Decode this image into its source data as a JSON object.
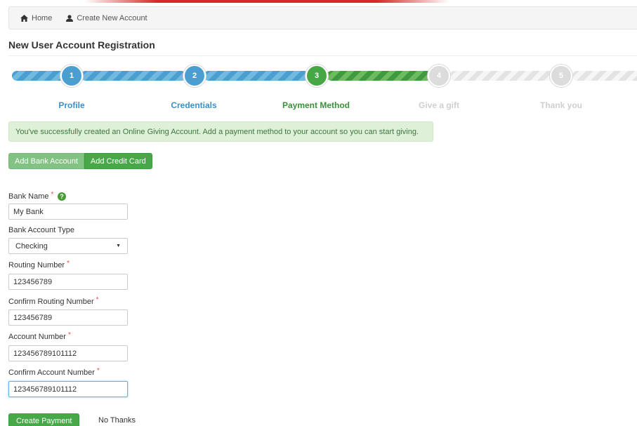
{
  "breadcrumb": {
    "home_label": "Home",
    "current_label": "Create New Account",
    "home_icon": "home-icon",
    "user_icon": "user-icon"
  },
  "page": {
    "title": "New User Account Registration"
  },
  "wizard": {
    "current_step": 3,
    "steps": [
      {
        "number": "1",
        "label": "Profile",
        "state": "complete"
      },
      {
        "number": "2",
        "label": "Credentials",
        "state": "complete"
      },
      {
        "number": "3",
        "label": "Payment Method",
        "state": "active"
      },
      {
        "number": "4",
        "label": "Give a gift",
        "state": "pending"
      },
      {
        "number": "5",
        "label": "Thank you",
        "state": "pending"
      }
    ]
  },
  "alert": {
    "message": "You've successfully created an Online Giving Account. Add a payment method to your account so you can start giving."
  },
  "payment_tabs": {
    "bank_label": "Add Bank Account",
    "card_label": "Add Credit Card",
    "selected": "Add Bank Account"
  },
  "form": {
    "bank_name": {
      "label": "Bank Name",
      "value": "My Bank",
      "required": true,
      "help_icon": "question-circle-icon"
    },
    "account_type": {
      "label": "Bank Account Type",
      "value": "Checking"
    },
    "routing_number": {
      "label": "Routing Number",
      "value": "123456789",
      "required": true
    },
    "confirm_routing_number": {
      "label": "Confirm Routing Number",
      "value": "123456789",
      "required": true
    },
    "account_number": {
      "label": "Account Number",
      "value": "123456789101112",
      "required": true
    },
    "confirm_account_number": {
      "label": "Confirm Account Number",
      "value": "123456789101112",
      "required": true
    },
    "required_marker": "*"
  },
  "actions": {
    "submit_label": "Create Payment",
    "skip_label": "No Thanks"
  },
  "colors": {
    "complete": "#4a9fd0",
    "active": "#45a845",
    "pending": "#dcdcdc",
    "alert_bg": "#dff0d8",
    "alert_text": "#3c763d",
    "required": "#d9534f"
  }
}
